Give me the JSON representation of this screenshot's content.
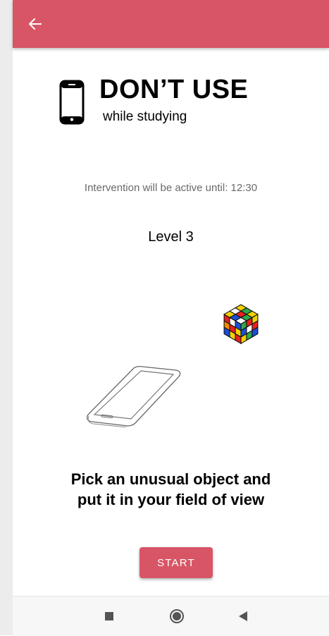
{
  "app_bar": {
    "back_icon": "arrow-left-icon",
    "color": "#d85565"
  },
  "header": {
    "icon": "smartphone-icon",
    "title": "DON’T USE",
    "subtitle": "while studying"
  },
  "intervention_text": "Intervention will be active until: 12:30",
  "level_text": "Level 3",
  "illustrations": {
    "cube": "rubiks-cube-icon",
    "phone": "phone-outline-illustration"
  },
  "instruction_line1": "Pick an unusual object and",
  "instruction_line2": "put it in your field of view",
  "start_button": {
    "label": "START",
    "color": "#d85565"
  },
  "nav_bar": {
    "recents": "square-icon",
    "home": "circle-icon",
    "back": "triangle-back-icon"
  }
}
